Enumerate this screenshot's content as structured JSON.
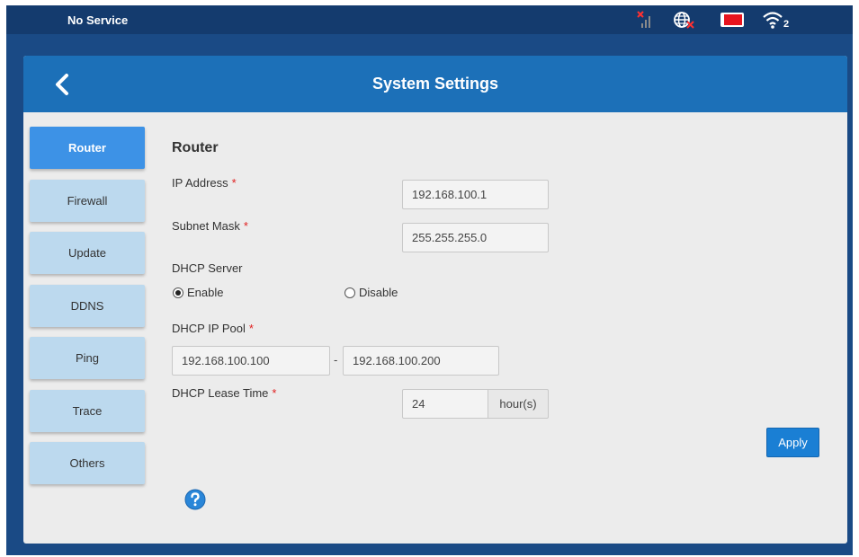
{
  "status_bar": {
    "service_text": "No Service",
    "icons": [
      "no-signal-icon",
      "no-internet-icon",
      "sim-card-icon",
      "wifi-icon"
    ],
    "wifi_badge": "2"
  },
  "header": {
    "title": "System Settings",
    "back_icon": "chevron-left-icon"
  },
  "sidebar": {
    "items": [
      {
        "label": "Router",
        "active": true
      },
      {
        "label": "Firewall",
        "active": false
      },
      {
        "label": "Update",
        "active": false
      },
      {
        "label": "DDNS",
        "active": false
      },
      {
        "label": "Ping",
        "active": false
      },
      {
        "label": "Trace",
        "active": false
      },
      {
        "label": "Others",
        "active": false
      }
    ]
  },
  "form": {
    "section_title": "Router",
    "required_mark": "*",
    "ip_address": {
      "label": "IP Address",
      "value": "192.168.100.1"
    },
    "subnet_mask": {
      "label": "Subnet Mask",
      "value": "255.255.255.0"
    },
    "dhcp_server": {
      "label": "DHCP Server",
      "enable_label": "Enable",
      "disable_label": "Disable",
      "selected": "Enable"
    },
    "dhcp_ip_pool": {
      "label": "DHCP IP Pool",
      "start": "192.168.100.100",
      "separator": "-",
      "end": "192.168.100.200"
    },
    "dhcp_lease_time": {
      "label": "DHCP Lease Time",
      "value": "24",
      "unit": "hour(s)"
    },
    "apply_label": "Apply"
  },
  "help_icon": "question-circle-icon",
  "colors": {
    "header_blue": "#1c70b8",
    "frame_blue": "#1a4a85",
    "active_tab": "#3d92e6",
    "inactive_tab": "#bcd9ee",
    "apply_button": "#1a7fd4",
    "required": "#e02020"
  }
}
